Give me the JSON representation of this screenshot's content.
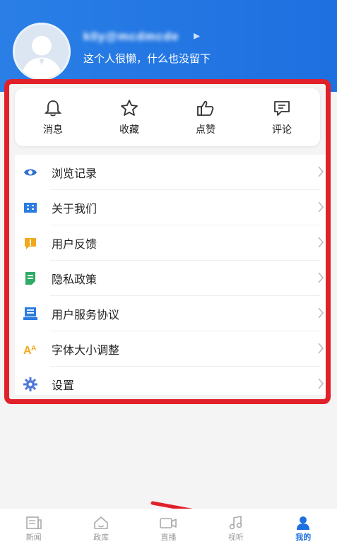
{
  "profile": {
    "username": "k0y@mcdmcde",
    "signature": "这个人很懒，什么也没留下"
  },
  "quick_actions": [
    {
      "label": "消息",
      "icon": "bell-icon"
    },
    {
      "label": "收藏",
      "icon": "star-icon"
    },
    {
      "label": "点赞",
      "icon": "thumbs-up-icon"
    },
    {
      "label": "评论",
      "icon": "comment-icon"
    }
  ],
  "menu": [
    {
      "label": "浏览记录",
      "icon": "eye-icon",
      "color": "#2f6fcf"
    },
    {
      "label": "关于我们",
      "icon": "building-icon",
      "color": "#2b7be0"
    },
    {
      "label": "用户反馈",
      "icon": "feedback-icon",
      "color": "#f0a81c"
    },
    {
      "label": "隐私政策",
      "icon": "document-icon",
      "color": "#2fab67"
    },
    {
      "label": "用户服务协议",
      "icon": "agreement-icon",
      "color": "#2b7be0"
    },
    {
      "label": "字体大小调整",
      "icon": "font-size-icon",
      "color": "#f0a81c"
    },
    {
      "label": "设置",
      "icon": "gear-icon",
      "color": "#4f78d8"
    }
  ],
  "bottom_nav": [
    {
      "label": "新闻",
      "icon": "news-icon"
    },
    {
      "label": "政库",
      "icon": "home-icon"
    },
    {
      "label": "直播",
      "icon": "video-icon"
    },
    {
      "label": "视听",
      "icon": "music-icon"
    },
    {
      "label": "我的",
      "icon": "profile-icon",
      "active": true
    }
  ],
  "colors": {
    "brand_blue": "#1e6fe0",
    "highlight_red": "#e1212a"
  }
}
